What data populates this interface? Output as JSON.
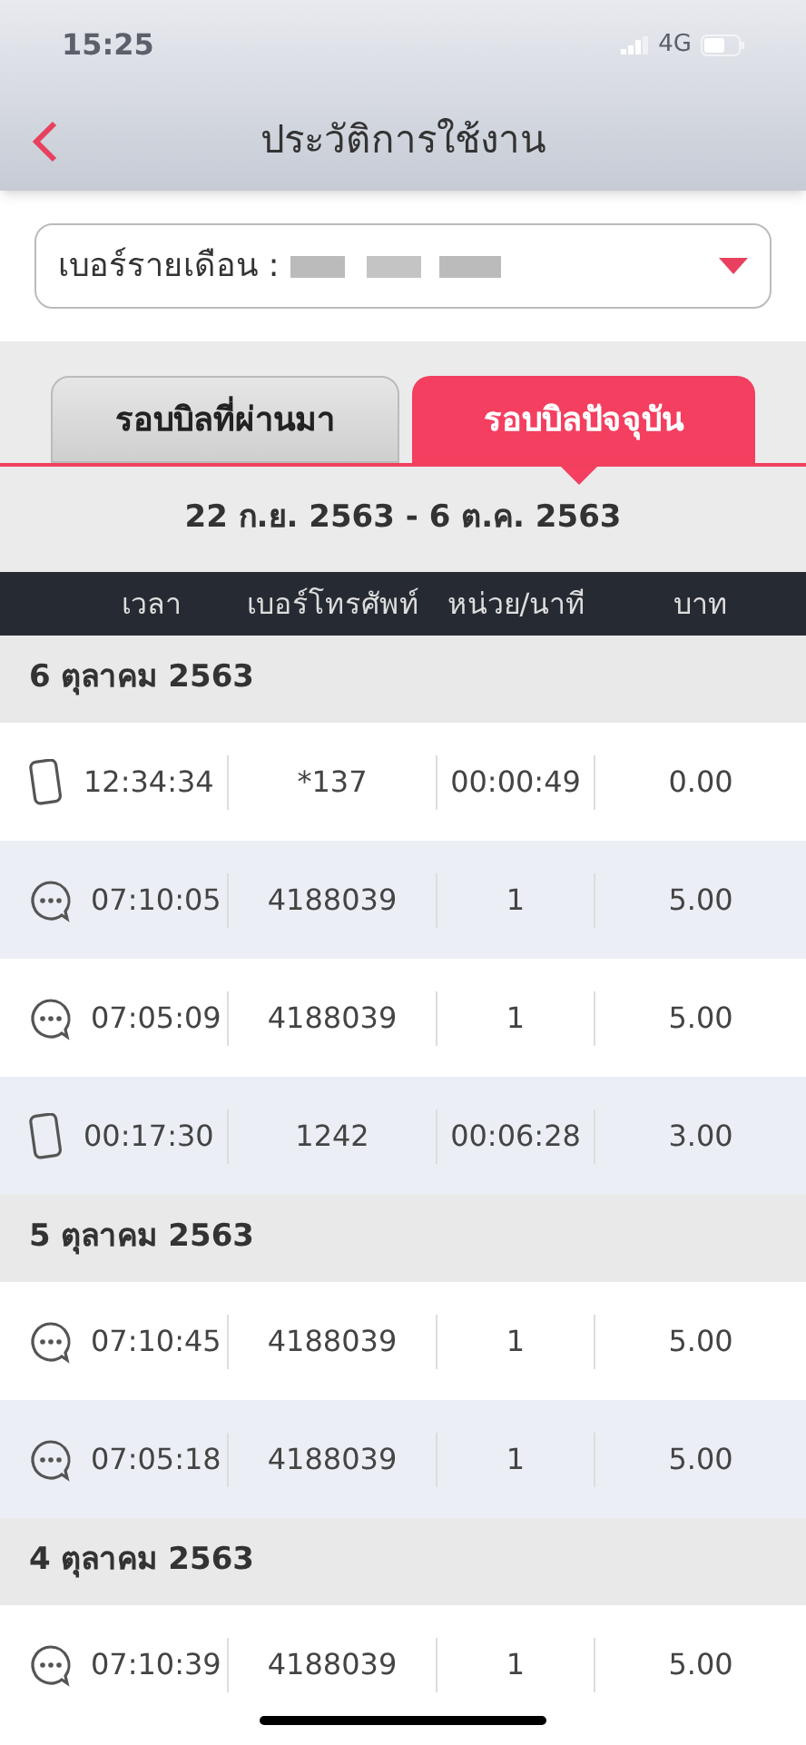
{
  "status_bar": {
    "time": "15:25",
    "network": "4G"
  },
  "header": {
    "title": "ประวัติการใช้งาน"
  },
  "number_select": {
    "label": "เบอร์รายเดือน :"
  },
  "tabs": [
    {
      "label": "รอบบิลที่ผ่านมา",
      "selected": false
    },
    {
      "label": "รอบบิลปัจจุบัน",
      "selected": true
    }
  ],
  "period": "22 ก.ย. 2563 - 6 ต.ค. 2563",
  "table": {
    "columns": [
      "เวลา",
      "เบอร์โทรศัพท์",
      "หน่วย/นาที",
      "บาท"
    ],
    "groups": [
      {
        "date": "6 ตุลาคม 2563",
        "rows": [
          {
            "kind": "call",
            "time": "12:34:34",
            "number": "*137",
            "units": "00:00:49",
            "baht": "0.00"
          },
          {
            "kind": "sms",
            "time": "07:10:05",
            "number": "4188039",
            "units": "1",
            "baht": "5.00"
          },
          {
            "kind": "sms",
            "time": "07:05:09",
            "number": "4188039",
            "units": "1",
            "baht": "5.00"
          },
          {
            "kind": "call",
            "time": "00:17:30",
            "number": "1242",
            "units": "00:06:28",
            "baht": "3.00"
          }
        ]
      },
      {
        "date": "5 ตุลาคม 2563",
        "rows": [
          {
            "kind": "sms",
            "time": "07:10:45",
            "number": "4188039",
            "units": "1",
            "baht": "5.00"
          },
          {
            "kind": "sms",
            "time": "07:05:18",
            "number": "4188039",
            "units": "1",
            "baht": "5.00"
          }
        ]
      },
      {
        "date": "4 ตุลาคม 2563",
        "rows": [
          {
            "kind": "sms",
            "time": "07:10:39",
            "number": "4188039",
            "units": "1",
            "baht": "5.00"
          }
        ]
      }
    ]
  }
}
